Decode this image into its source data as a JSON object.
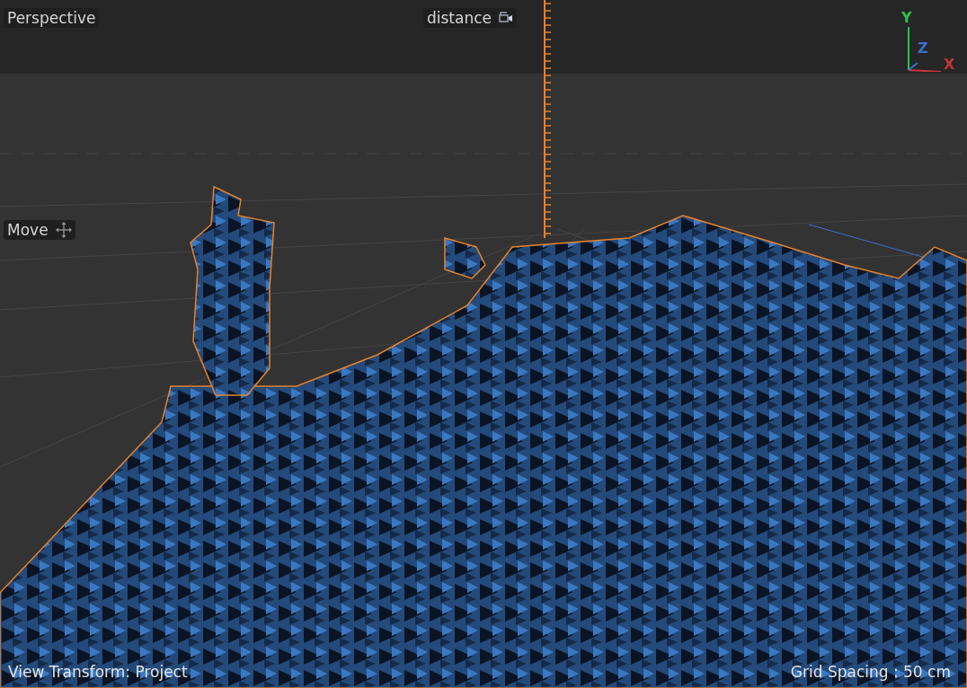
{
  "viewport": {
    "view_name": "Perspective",
    "camera_label": "distance",
    "tool_label": "Move"
  },
  "axes": [
    {
      "label": "Y",
      "color": "#2fc24a"
    },
    {
      "label": "Z",
      "color": "#3a6fd8"
    },
    {
      "label": "X",
      "color": "#c4353a"
    }
  ],
  "status": {
    "view_transform": "View Transform: Project",
    "grid_spacing": "Grid Spacing : 50 cm"
  }
}
